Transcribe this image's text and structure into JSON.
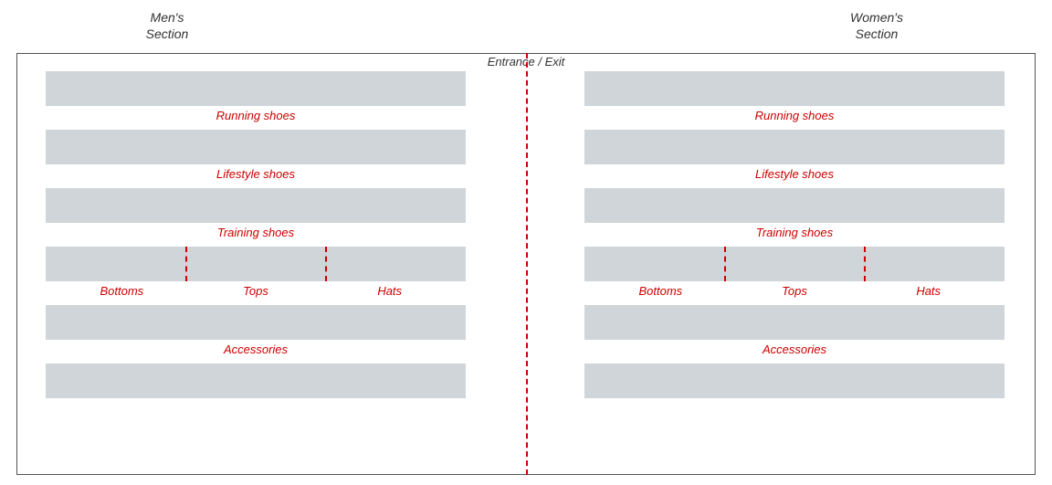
{
  "mens_section_label": "Men's\nSection",
  "womens_section_label": "Women's\nSection",
  "entrance_label": "Entrance / Exit",
  "mens_shelves": [
    {
      "label": "Running shoes"
    },
    {
      "label": "Lifestyle shoes"
    },
    {
      "label": "Training shoes"
    }
  ],
  "clothing_labels": [
    "Bottoms",
    "Tops",
    "Hats"
  ],
  "accessories_label": "Accessories",
  "womens_shelves": [
    {
      "label": "Running shoes"
    },
    {
      "label": "Lifestyle shoes"
    },
    {
      "label": "Training shoes"
    }
  ],
  "womens_clothing_labels": [
    "Bottoms",
    "Tops",
    "Hats"
  ],
  "womens_accessories_label": "Accessories"
}
